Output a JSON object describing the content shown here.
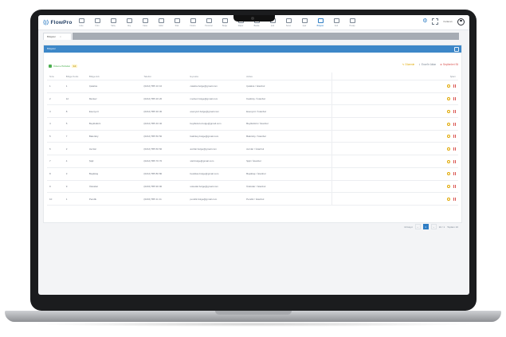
{
  "app": {
    "logo_text": "FlowPro",
    "logo_mark": "⟨|⟩"
  },
  "nav": {
    "items": [
      {
        "label": "Liste",
        "active": false
      },
      {
        "label": "Ürün",
        "active": false
      },
      {
        "label": "Satış",
        "active": false
      },
      {
        "label": "Alış",
        "active": false
      },
      {
        "label": "Kasa",
        "active": false
      },
      {
        "label": "Gider",
        "active": false
      },
      {
        "label": "Stok",
        "active": false
      },
      {
        "label": "Finans",
        "active": false
      },
      {
        "label": "Personel",
        "active": false
      },
      {
        "label": "Belge",
        "active": false
      },
      {
        "label": "Rapor",
        "active": false
      },
      {
        "label": "Banka",
        "active": false
      },
      {
        "label": "Çek",
        "active": false
      },
      {
        "label": "Senet",
        "active": false
      },
      {
        "label": "Ayar",
        "active": false
      },
      {
        "label": "Bölgeler",
        "active": true
      },
      {
        "label": "Kod",
        "active": false
      },
      {
        "label": "Hesap",
        "active": false
      }
    ],
    "user_name": "Kullanıcı",
    "icons": [
      "gear-icon",
      "expand-icon",
      "user-avatar-icon"
    ]
  },
  "tab": {
    "label": "Bölgeler",
    "close": "×"
  },
  "card": {
    "title": "Bölgeler"
  },
  "toolbar": {
    "checkbox_label": "Ödeme/Tahsilat",
    "chip": "14"
  },
  "actions": {
    "edit": "Düzenle",
    "export": "Excel'e Aktar",
    "delete": "Seçilenleri Sil"
  },
  "table": {
    "headers": [
      "Sıra",
      "Bölge Kodu",
      "Bölge Adı",
      "Telefon",
      "E-posta",
      "Adres",
      "İşlem"
    ],
    "rows": [
      [
        "1",
        "1",
        "Çatalca",
        "(0212) 555 10 10",
        "catalca.bolge@gmail.com",
        "Çatalca / İstanbul"
      ],
      [
        "2",
        "12",
        "Merkez",
        "(0212) 555 20 20",
        "merkez.bolge@gmail.com",
        "Kadıköy / İstanbul"
      ],
      [
        "3",
        "8",
        "Esenyurt",
        "(0212) 555 30 30",
        "esenyurt.bolge@gmail.com",
        "Esenyurt / İstanbul"
      ],
      [
        "4",
        "5",
        "Beylikdüzü",
        "(0212) 555 40 40",
        "beylikduzu.bolge@gmail.com",
        "Beylikdüzü / İstanbul"
      ],
      [
        "5",
        "7",
        "Bakırköy",
        "(0212) 555 50 50",
        "bakirkoy.bolge@gmail.com",
        "Bakırköy / İstanbul"
      ],
      [
        "6",
        "2",
        "Avcılar",
        "(0212) 555 60 60",
        "avcilar.bolge@gmail.com",
        "Avcılar / İstanbul"
      ],
      [
        "7",
        "4",
        "Şişli",
        "(0212) 555 70 70",
        "sisli.bolge@gmail.com",
        "Şişli / İstanbul"
      ],
      [
        "8",
        "3",
        "Beşiktaş",
        "(0212) 555 80 80",
        "besiktas.bolge@gmail.com",
        "Beşiktaş / İstanbul"
      ],
      [
        "9",
        "9",
        "Üsküdar",
        "(0216) 555 90 90",
        "uskudar.bolge@gmail.com",
        "Üsküdar / İstanbul"
      ],
      [
        "10",
        "1",
        "Pendik",
        "(0216) 555 11 11",
        "pendik.bolge@gmail.com",
        "Pendik / İstanbul"
      ]
    ]
  },
  "pager": {
    "per_page": "10 kayıt",
    "prev": "‹",
    "page": "1",
    "next": "›",
    "total": "10 / 1",
    "summary": "Toplam 10"
  },
  "colors": {
    "accent": "#2e7dc4",
    "header_bar": "#3d87c8",
    "edit": "#e0a800",
    "delete": "#d9534f"
  }
}
